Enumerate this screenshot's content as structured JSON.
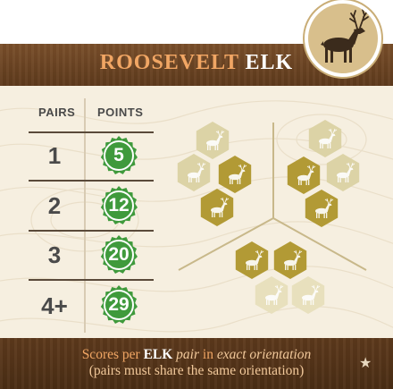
{
  "card": {
    "title_prefix": "ROOSEVELT ",
    "title_emph": "ELK",
    "badge_icon": "elk-icon",
    "columns": {
      "pairs": "PAIRS",
      "points": "POINTS"
    },
    "rows": [
      {
        "pairs": "1",
        "points": "5"
      },
      {
        "pairs": "2",
        "points": "12"
      },
      {
        "pairs": "3",
        "points": "20"
      },
      {
        "pairs": "4+",
        "points": "29"
      }
    ],
    "rule_line1": {
      "a": "Scores per ",
      "b": "ELK",
      "c": " pair",
      "d": " in ",
      "e": "exact orientation"
    },
    "rule_line2": "(pairs must share the same orientation)",
    "footer_icon": "star-icon",
    "colors": {
      "header_brown": "#6b4423",
      "title_orange": "#f1a664",
      "points_green": "#3f9a3c",
      "hex_gold": "#b29a35",
      "hex_faded": "#dcd3a6",
      "parchment": "#f6efe0"
    }
  }
}
